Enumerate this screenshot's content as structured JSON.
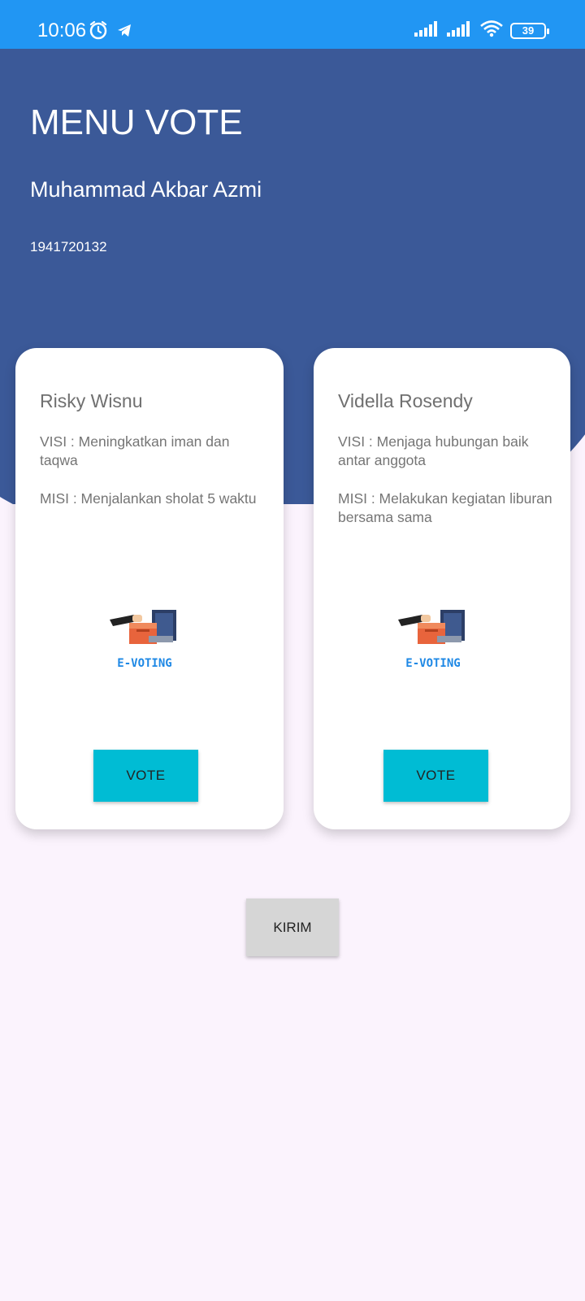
{
  "statusbar": {
    "time": "10:06",
    "battery": "39",
    "icons": [
      "alarm-icon",
      "telegram-icon",
      "signal-icon",
      "signal-icon",
      "wifi-icon",
      "battery-icon"
    ],
    "color": "#2196f3"
  },
  "header": {
    "title": "MENU VOTE",
    "user_name": "Muhammad Akbar Azmi",
    "user_id": "1941720132",
    "color": "#3b5998"
  },
  "candidates": [
    {
      "name": "Risky Wisnu",
      "visi": "VISI : Meningkatkan iman dan taqwa",
      "misi": "MISI : Menjalankan sholat 5 waktu",
      "logo_text": "E-VOTING",
      "vote_label": "VOTE"
    },
    {
      "name": "Vidella Rosendy",
      "visi": "VISI : Menjaga hubungan baik antar anggota",
      "misi": "MISI : Melakukan kegiatan liburan bersama sama",
      "logo_text": "E-VOTING",
      "vote_label": "VOTE"
    }
  ],
  "submit_label": "KIRIM",
  "colors": {
    "vote_button": "#00bcd4",
    "submit_button": "#d6d6d6",
    "background": "#fbf3fd"
  }
}
